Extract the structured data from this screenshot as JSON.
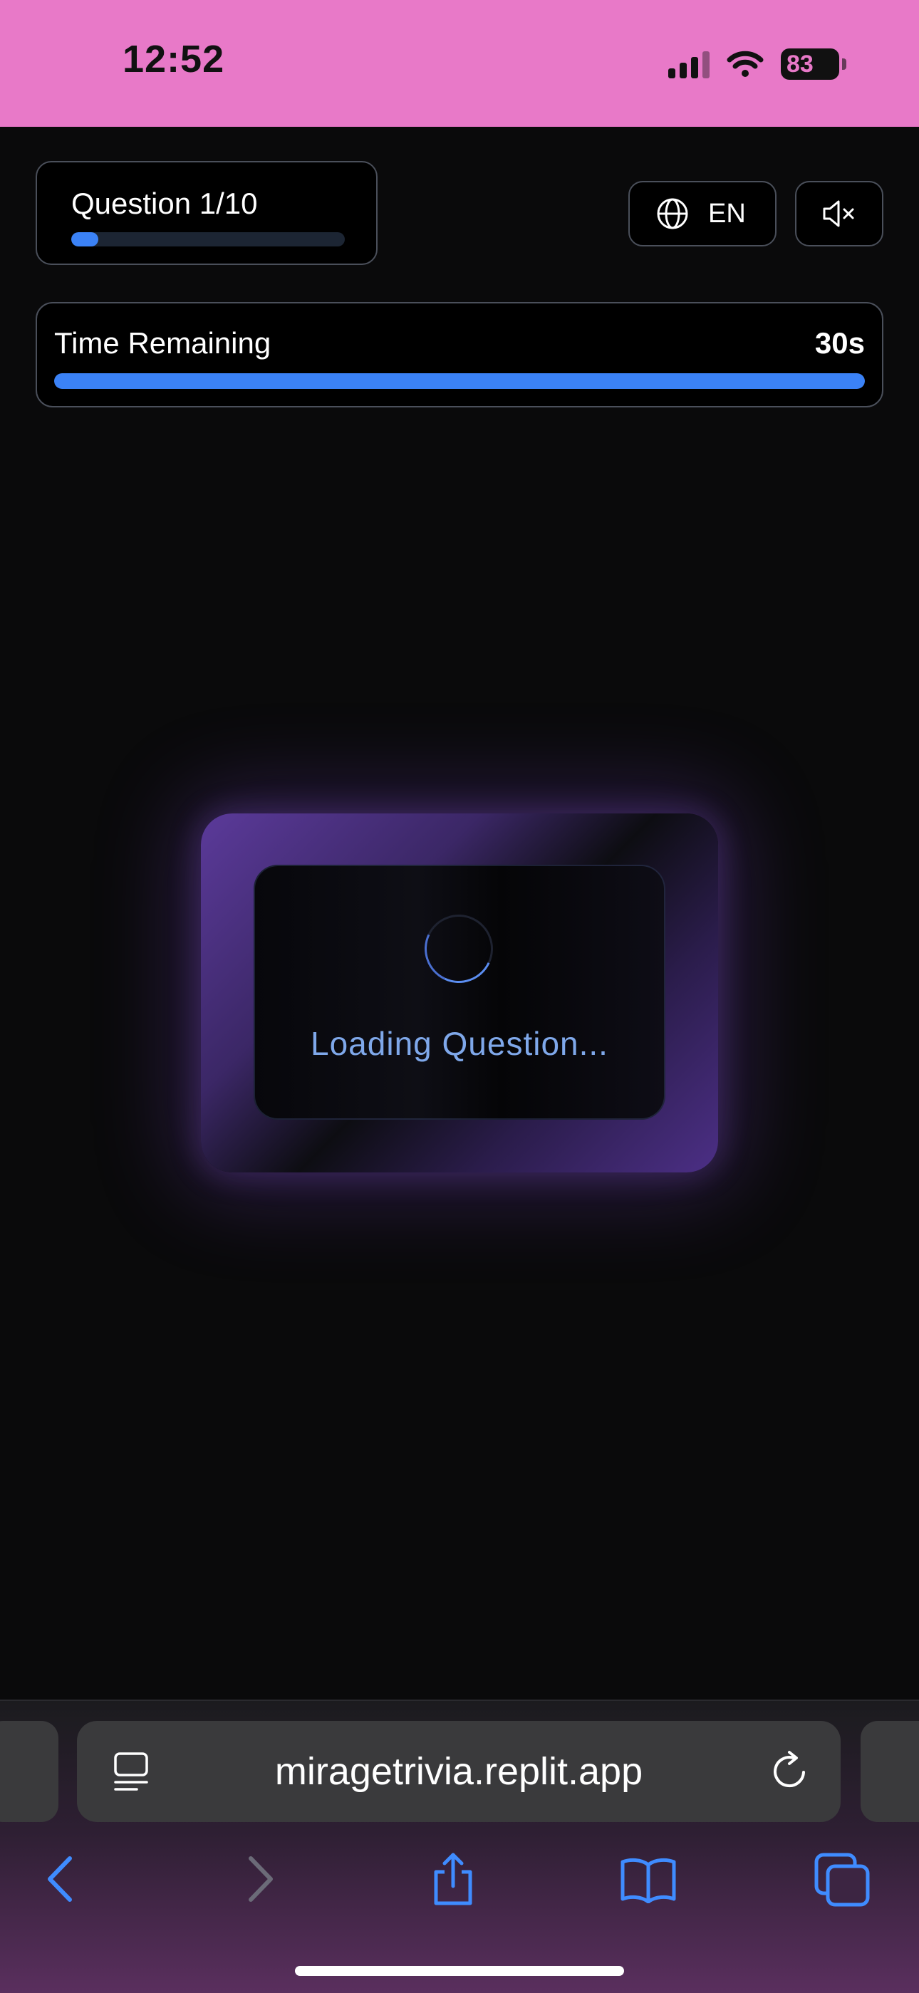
{
  "status_bar": {
    "time": "12:52",
    "battery": "83"
  },
  "header": {
    "question_label": "Question 1/10",
    "question_progress": 0.1,
    "language": "EN"
  },
  "timer": {
    "label": "Time Remaining",
    "value": "30s",
    "progress": 1.0
  },
  "loading": {
    "text": "Loading Question..."
  },
  "browser": {
    "url": "miragetrivia.replit.app"
  },
  "colors": {
    "accent": "#3b82f6",
    "status_bar": "#e879c8",
    "loading_text": "#7fa8ea",
    "glow": "#5b3a9a"
  },
  "icons": [
    "globe-icon",
    "mute-icon",
    "reader-icon",
    "reload-icon",
    "back-icon",
    "forward-icon",
    "share-icon",
    "bookmarks-icon",
    "tabs-icon"
  ]
}
